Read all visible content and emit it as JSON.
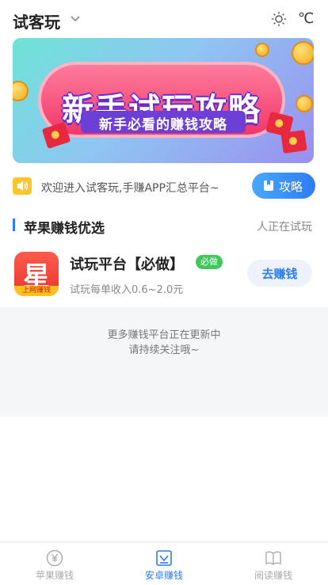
{
  "header": {
    "title": "试客玩",
    "chevron_icon": "chevron-down-icon",
    "weather_icon": "sun-icon",
    "temperature_unit": "℃"
  },
  "banner": {
    "title": "新手试玩攻略",
    "subtitle": "新手必看的赚钱攻略"
  },
  "notice": {
    "icon": "speaker-icon",
    "text": "欢迎进入试客玩,手赚APP汇总平台~",
    "button_label": "攻略",
    "button_icon": "bookmark-icon"
  },
  "section": {
    "title": "苹果赚钱优选",
    "right_text": "人正在试玩"
  },
  "platforms": [
    {
      "logo_glyph": "星",
      "logo_tag": "上网赚钱",
      "name": "试玩平台【必做】",
      "badge": "必做",
      "description": "试玩每单收入0.6~2.0元",
      "button_label": "去赚钱"
    }
  ],
  "more": {
    "line1": "更多赚钱平台正在更新中",
    "line2": "请持续关注哦~"
  },
  "tabs": [
    {
      "label": "苹果赚钱",
      "icon": "yen-icon",
      "active": false
    },
    {
      "label": "安卓赚钱",
      "icon": "android-icon",
      "active": true
    },
    {
      "label": "阅读赚钱",
      "icon": "book-icon",
      "active": false
    }
  ],
  "colors": {
    "accent": "#2d7cf2",
    "badge_green": "#40c85a",
    "banner_pink": "#f0386a"
  }
}
